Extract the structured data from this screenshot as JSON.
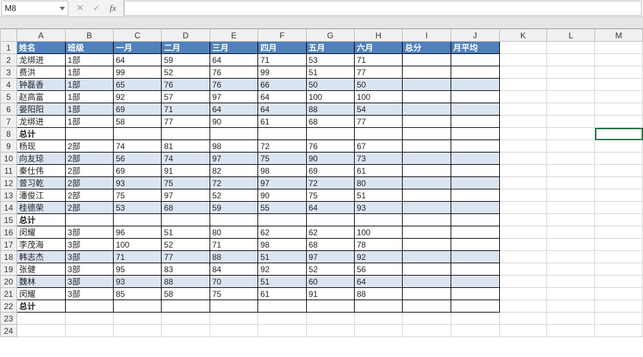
{
  "formula_bar": {
    "cell_ref": "M8",
    "cancel_icon": "✕",
    "confirm_icon": "✓",
    "fx_label": "fx",
    "formula_value": ""
  },
  "columns": [
    "A",
    "B",
    "C",
    "D",
    "E",
    "F",
    "G",
    "H",
    "I",
    "J",
    "K",
    "L",
    "M"
  ],
  "row_numbers": [
    "1",
    "2",
    "3",
    "4",
    "5",
    "6",
    "7",
    "8",
    "9",
    "10",
    "11",
    "12",
    "13",
    "14",
    "15",
    "16",
    "17",
    "18",
    "19",
    "20",
    "21",
    "22",
    "23",
    "24"
  ],
  "selected_cell": "M8",
  "chart_data": {
    "type": "table",
    "headers": [
      "姓名",
      "班级",
      "一月",
      "二月",
      "三月",
      "四月",
      "五月",
      "六月",
      "总分",
      "月平均"
    ],
    "rows": [
      {
        "name": "龙绑进",
        "cls": "1部",
        "m": [
          64,
          59,
          64,
          71,
          53,
          71
        ],
        "total": "",
        "avg": "",
        "subtotal": false,
        "alt": false
      },
      {
        "name": "费洪",
        "cls": "1部",
        "m": [
          99,
          52,
          76,
          99,
          51,
          77
        ],
        "total": "",
        "avg": "",
        "subtotal": false,
        "alt": false
      },
      {
        "name": "钟磊香",
        "cls": "1部",
        "m": [
          65,
          76,
          76,
          66,
          50,
          50
        ],
        "total": "",
        "avg": "",
        "subtotal": false,
        "alt": true
      },
      {
        "name": "赵高富",
        "cls": "1部",
        "m": [
          92,
          57,
          97,
          64,
          100,
          100
        ],
        "total": "",
        "avg": "",
        "subtotal": false,
        "alt": false
      },
      {
        "name": "晏阳阳",
        "cls": "1部",
        "m": [
          69,
          71,
          64,
          64,
          88,
          54
        ],
        "total": "",
        "avg": "",
        "subtotal": false,
        "alt": true
      },
      {
        "name": "龙绑进",
        "cls": "1部",
        "m": [
          58,
          77,
          90,
          61,
          68,
          77
        ],
        "total": "",
        "avg": "",
        "subtotal": false,
        "alt": false
      },
      {
        "name": "总计",
        "cls": "",
        "m": [
          "",
          "",
          "",
          "",
          "",
          ""
        ],
        "total": "",
        "avg": "",
        "subtotal": true,
        "alt": false
      },
      {
        "name": "杨现",
        "cls": "2部",
        "m": [
          74,
          81,
          98,
          72,
          76,
          67
        ],
        "total": "",
        "avg": "",
        "subtotal": false,
        "alt": false
      },
      {
        "name": "向友琼",
        "cls": "2部",
        "m": [
          56,
          74,
          97,
          75,
          90,
          73
        ],
        "total": "",
        "avg": "",
        "subtotal": false,
        "alt": true
      },
      {
        "name": "秦仕伟",
        "cls": "2部",
        "m": [
          69,
          91,
          82,
          98,
          69,
          61
        ],
        "total": "",
        "avg": "",
        "subtotal": false,
        "alt": false
      },
      {
        "name": "曾习乾",
        "cls": "2部",
        "m": [
          93,
          75,
          72,
          97,
          72,
          80
        ],
        "total": "",
        "avg": "",
        "subtotal": false,
        "alt": true
      },
      {
        "name": "潘俊江",
        "cls": "2部",
        "m": [
          75,
          97,
          52,
          90,
          75,
          51
        ],
        "total": "",
        "avg": "",
        "subtotal": false,
        "alt": false
      },
      {
        "name": "桂德荣",
        "cls": "2部",
        "m": [
          53,
          68,
          59,
          55,
          64,
          93
        ],
        "total": "",
        "avg": "",
        "subtotal": false,
        "alt": true
      },
      {
        "name": "总计",
        "cls": "",
        "m": [
          "",
          "",
          "",
          "",
          "",
          ""
        ],
        "total": "",
        "avg": "",
        "subtotal": true,
        "alt": false
      },
      {
        "name": "闵耀",
        "cls": "3部",
        "m": [
          96,
          51,
          80,
          62,
          62,
          100
        ],
        "total": "",
        "avg": "",
        "subtotal": false,
        "alt": false
      },
      {
        "name": "李茂海",
        "cls": "3部",
        "m": [
          100,
          52,
          71,
          98,
          68,
          78
        ],
        "total": "",
        "avg": "",
        "subtotal": false,
        "alt": false
      },
      {
        "name": "韩志杰",
        "cls": "3部",
        "m": [
          71,
          77,
          88,
          51,
          97,
          92
        ],
        "total": "",
        "avg": "",
        "subtotal": false,
        "alt": true
      },
      {
        "name": "张健",
        "cls": "3部",
        "m": [
          95,
          83,
          84,
          92,
          52,
          56
        ],
        "total": "",
        "avg": "",
        "subtotal": false,
        "alt": false
      },
      {
        "name": "魏林",
        "cls": "3部",
        "m": [
          93,
          88,
          70,
          51,
          60,
          64
        ],
        "total": "",
        "avg": "",
        "subtotal": false,
        "alt": true
      },
      {
        "name": "闵耀",
        "cls": "3部",
        "m": [
          85,
          58,
          75,
          61,
          91,
          88
        ],
        "total": "",
        "avg": "",
        "subtotal": false,
        "alt": false
      },
      {
        "name": "总计",
        "cls": "",
        "m": [
          "",
          "",
          "",
          "",
          "",
          ""
        ],
        "total": "",
        "avg": "",
        "subtotal": true,
        "alt": false
      }
    ]
  }
}
